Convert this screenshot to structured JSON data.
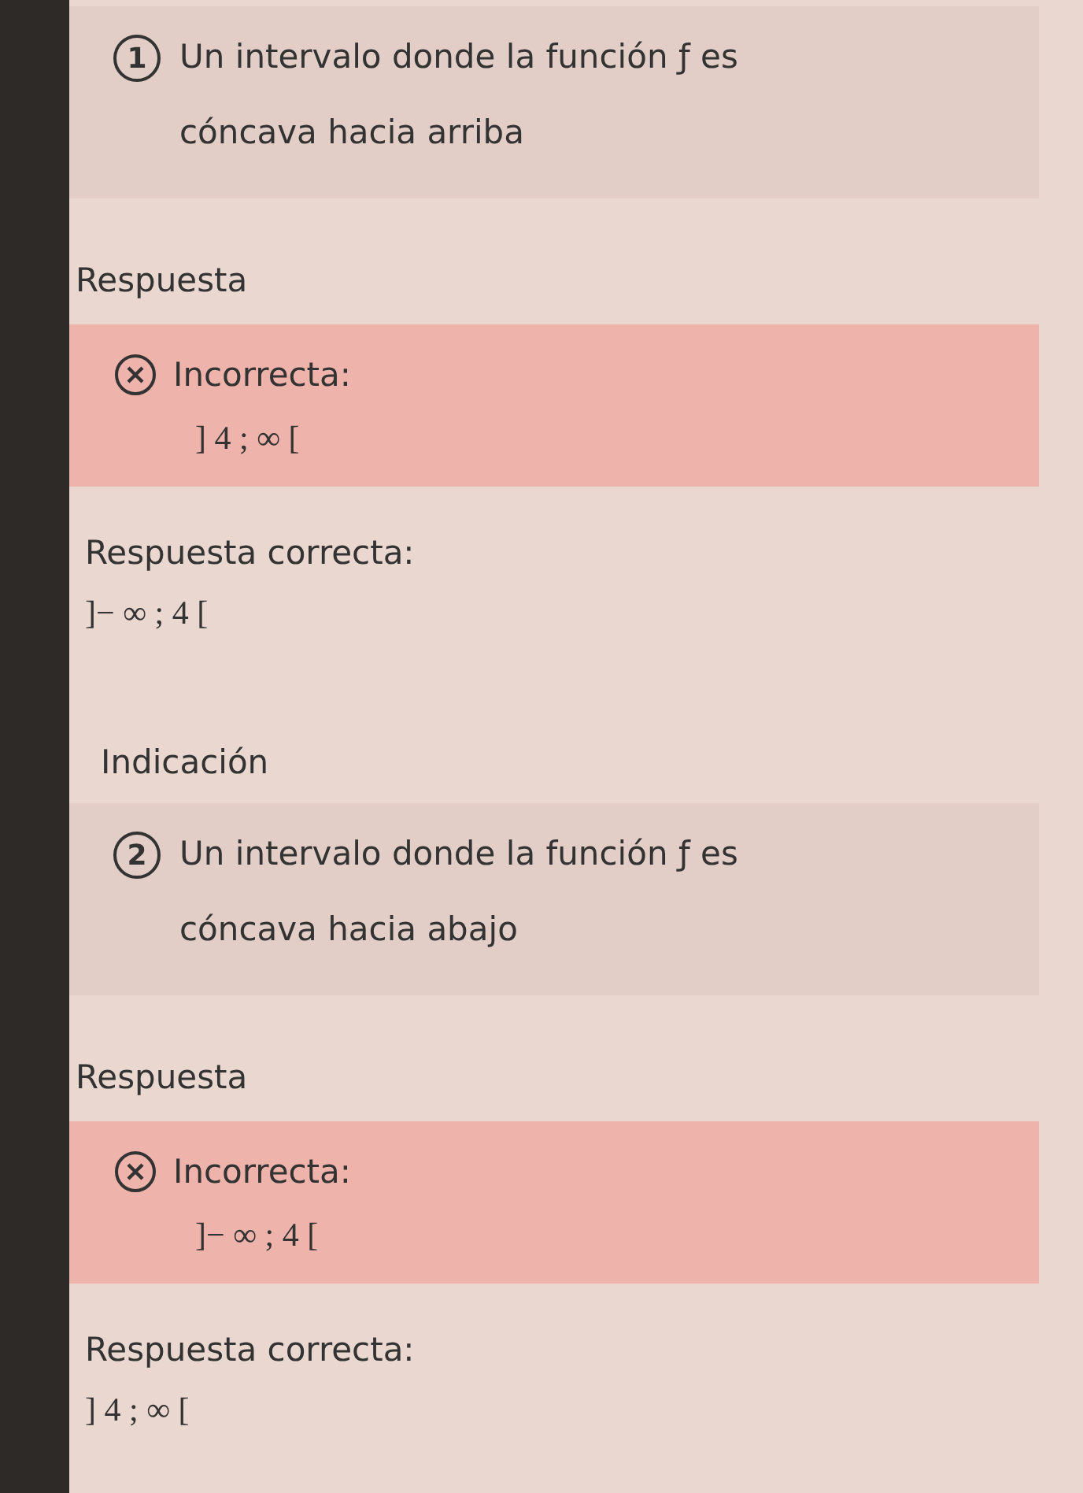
{
  "sections": [
    {
      "number": "1",
      "question": "Un intervalo donde la función ƒ es cóncava hacia arriba",
      "answer_heading": "Respuesta",
      "result": {
        "correct": false,
        "label": "Incorrecta:",
        "value": "] 4 ; ∞ ["
      },
      "correct_heading": "Respuesta correcta:",
      "correct_value": "]− ∞ ; 4 ["
    },
    {
      "heading": "Indicación",
      "number": "2",
      "question": "Un intervalo donde la función ƒ es cóncava hacia abajo",
      "answer_heading": "Respuesta",
      "result": {
        "correct": false,
        "label": "Incorrecta:",
        "value": "]− ∞ ; 4 ["
      },
      "correct_heading": "Respuesta correcta:",
      "correct_value": "] 4 ; ∞ ["
    }
  ]
}
